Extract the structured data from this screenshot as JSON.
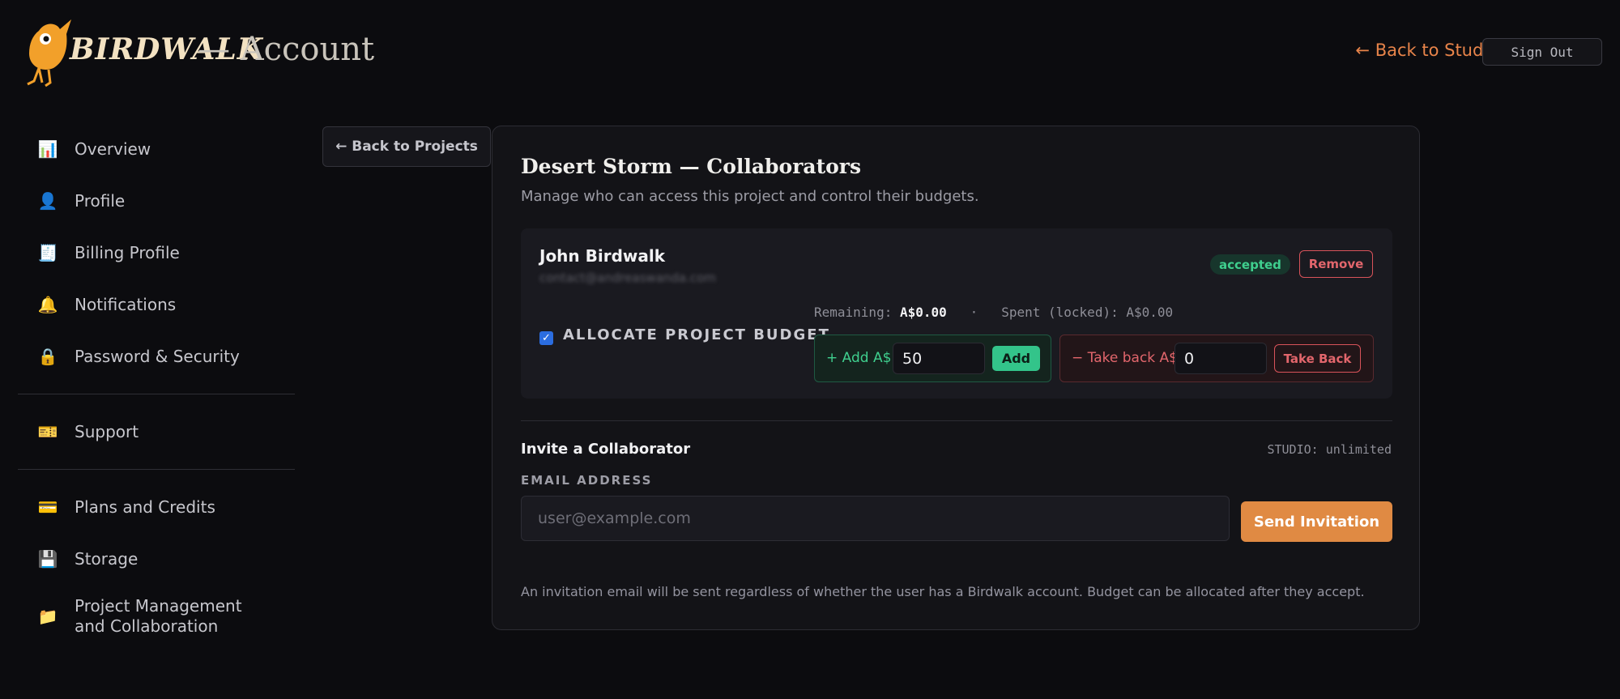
{
  "header": {
    "logo_word": "BIRDWALK",
    "title": "— Account",
    "back_link": "← Back to Studio",
    "sign_out": "Sign Out"
  },
  "sidebar": {
    "items": [
      {
        "label": "Overview",
        "icon": "bar-chart-icon",
        "glyph": "📊"
      },
      {
        "label": "Profile",
        "icon": "user-icon",
        "glyph": "👤"
      },
      {
        "label": "Billing Profile",
        "icon": "receipt-icon",
        "glyph": "🧾"
      },
      {
        "label": "Notifications",
        "icon": "bell-icon",
        "glyph": "🔔"
      },
      {
        "label": "Password & Security",
        "icon": "lock-icon",
        "glyph": "🔒"
      },
      {
        "label": "Support",
        "icon": "ticket-icon",
        "glyph": "🎫"
      },
      {
        "label": "Plans and Credits",
        "icon": "credit-card-icon",
        "glyph": "💳"
      },
      {
        "label": "Storage",
        "icon": "floppy-disk-icon",
        "glyph": "💾"
      },
      {
        "label": "Project Management and Collaboration",
        "icon": "folder-icon",
        "glyph": "📁"
      }
    ]
  },
  "back_projects": "← Back to Projects",
  "card": {
    "title": "Desert Storm — Collaborators",
    "subtitle": "Manage who can access this project and control their budgets."
  },
  "collaborator": {
    "name": "John Birdwalk",
    "email": "contact@andreaswanda.com",
    "status": "accepted",
    "remove_label": "Remove",
    "allocate_label": "ALLOCATE PROJECT BUDGET",
    "allocate_checked": true,
    "remaining_label": "Remaining:",
    "remaining_value": "A$0.00",
    "separator": "·",
    "spent_label": "Spent (locked): A$0.00",
    "add_label": "+ Add A$",
    "add_value": "50",
    "add_button": "Add",
    "take_label": "− Take back A$",
    "take_value": "0",
    "take_button": "Take Back"
  },
  "invite": {
    "title": "Invite a Collaborator",
    "plan": "STUDIO: unlimited",
    "email_label": "EMAIL ADDRESS",
    "email_placeholder": "user@example.com",
    "send_button": "Send Invitation",
    "footnote": "An invitation email will be sent regardless of whether the user has a Birdwalk account. Budget can be allocated after they accept."
  },
  "colors": {
    "accent": "#e08a43",
    "success": "#3fcf8e",
    "danger": "#e2666c",
    "background": "#0c0c0f"
  }
}
